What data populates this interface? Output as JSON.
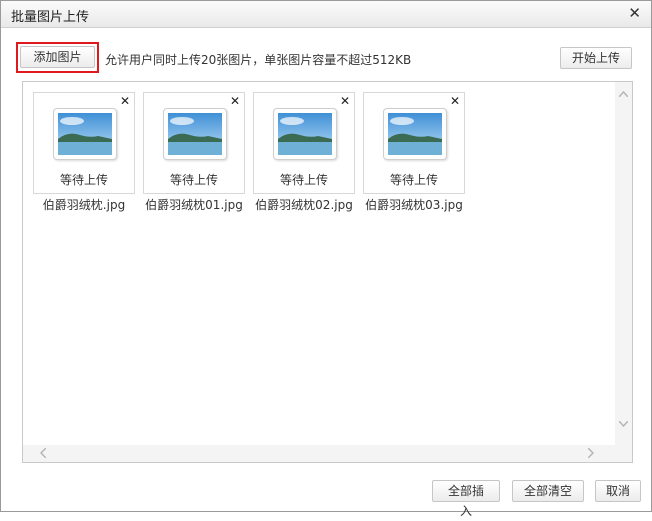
{
  "dialog": {
    "title": "批量图片上传",
    "close_symbol": "✕"
  },
  "toolbar": {
    "add_label": "添加图片",
    "hint": "允许用户同时上传20张图片，单张图片容量不超过512KB",
    "start_label": "开始上传"
  },
  "files": [
    {
      "name": "伯爵羽绒枕.jpg",
      "status": "等待上传",
      "remove": "✕"
    },
    {
      "name": "伯爵羽绒枕01.jpg",
      "status": "等待上传",
      "remove": "✕"
    },
    {
      "name": "伯爵羽绒枕02.jpg",
      "status": "等待上传",
      "remove": "✕"
    },
    {
      "name": "伯爵羽绒枕03.jpg",
      "status": "等待上传",
      "remove": "✕"
    }
  ],
  "footer": {
    "insert_all_label": "全部插入",
    "clear_all_label": "全部清空",
    "cancel_label": "取消"
  },
  "colors": {
    "highlight_border": "#e0191c",
    "panel_border": "#c9c9c9"
  },
  "icons": {
    "close": "close-icon",
    "remove": "remove-icon",
    "scroll_up": "scroll-up-icon",
    "scroll_down": "scroll-down-icon",
    "scroll_left": "scroll-left-icon",
    "scroll_right": "scroll-right-icon",
    "image_placeholder": "landscape-image-icon"
  }
}
